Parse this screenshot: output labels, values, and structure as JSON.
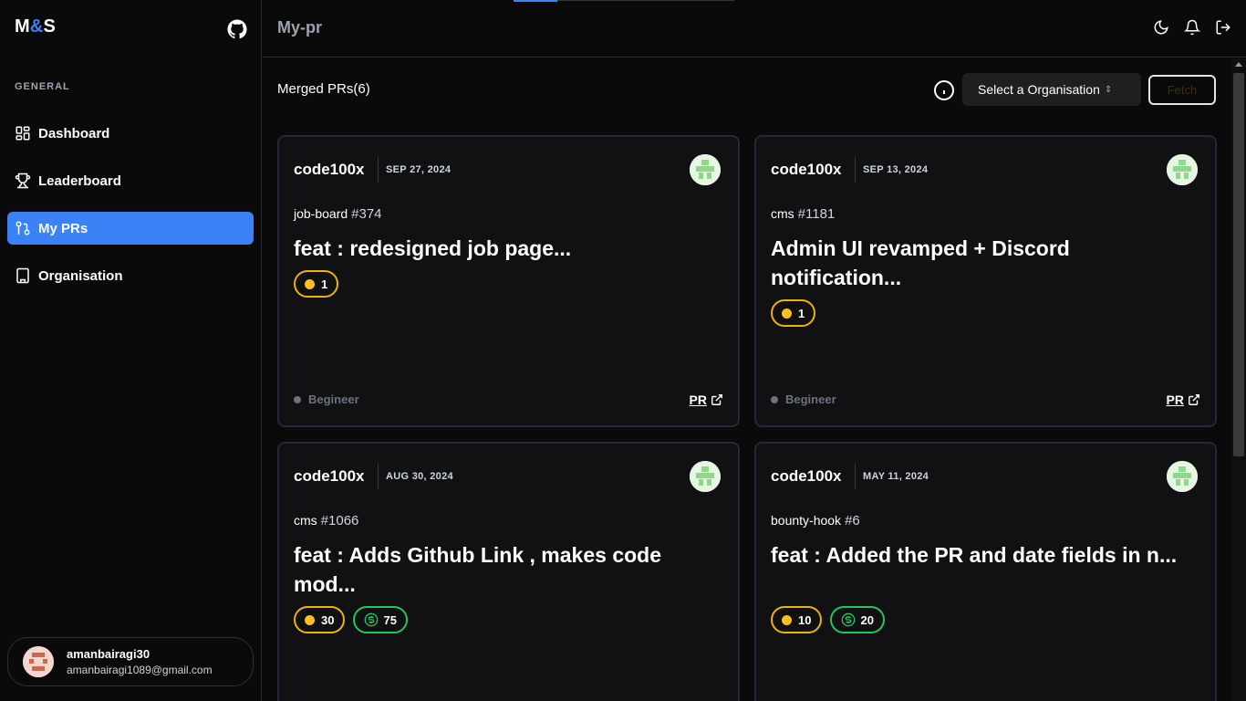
{
  "brand": {
    "left": "M",
    "amp": "&",
    "right": "S"
  },
  "sidebar": {
    "section_label": "GENERAL",
    "items": [
      {
        "label": "Dashboard",
        "icon": "dashboard-icon",
        "active": false
      },
      {
        "label": "Leaderboard",
        "icon": "trophy-icon",
        "active": false
      },
      {
        "label": "My PRs",
        "icon": "pull-request-icon",
        "active": true
      },
      {
        "label": "Organisation",
        "icon": "building-icon",
        "active": false
      }
    ],
    "user": {
      "name": "amanbairagi30",
      "email": "amanbairagi1089@gmail.com"
    }
  },
  "topbar": {
    "title": "My-pr"
  },
  "content": {
    "heading": "Merged PRs(6)",
    "select_label": "Select a Organisation",
    "fetch_label": "Fetch"
  },
  "cards": [
    {
      "org": "code100x",
      "date": "SEP 27, 2024",
      "repo": "job-board",
      "number": "#374",
      "title": "feat : redesigned job page...",
      "points": "1",
      "bounty": "",
      "level": "Begineer",
      "pr": "PR"
    },
    {
      "org": "code100x",
      "date": "SEP 13, 2024",
      "repo": "cms",
      "number": "#1181",
      "title": "Admin UI revamped + Discord notification...",
      "points": "1",
      "bounty": "",
      "level": "Begineer",
      "pr": "PR"
    },
    {
      "org": "code100x",
      "date": "AUG 30, 2024",
      "repo": "cms",
      "number": "#1066",
      "title": "feat : Adds Github Link , makes code mod...",
      "points": "30",
      "bounty": "75",
      "level": "",
      "pr": ""
    },
    {
      "org": "code100x",
      "date": "MAY 11, 2024",
      "repo": "bounty-hook",
      "number": "#6",
      "title": "feat : Added the PR and date fields in n...",
      "points": "10",
      "bounty": "20",
      "level": "",
      "pr": ""
    }
  ],
  "colors": {
    "accent": "#3b82f6",
    "points": "#eab308",
    "bounty": "#22c55e"
  }
}
